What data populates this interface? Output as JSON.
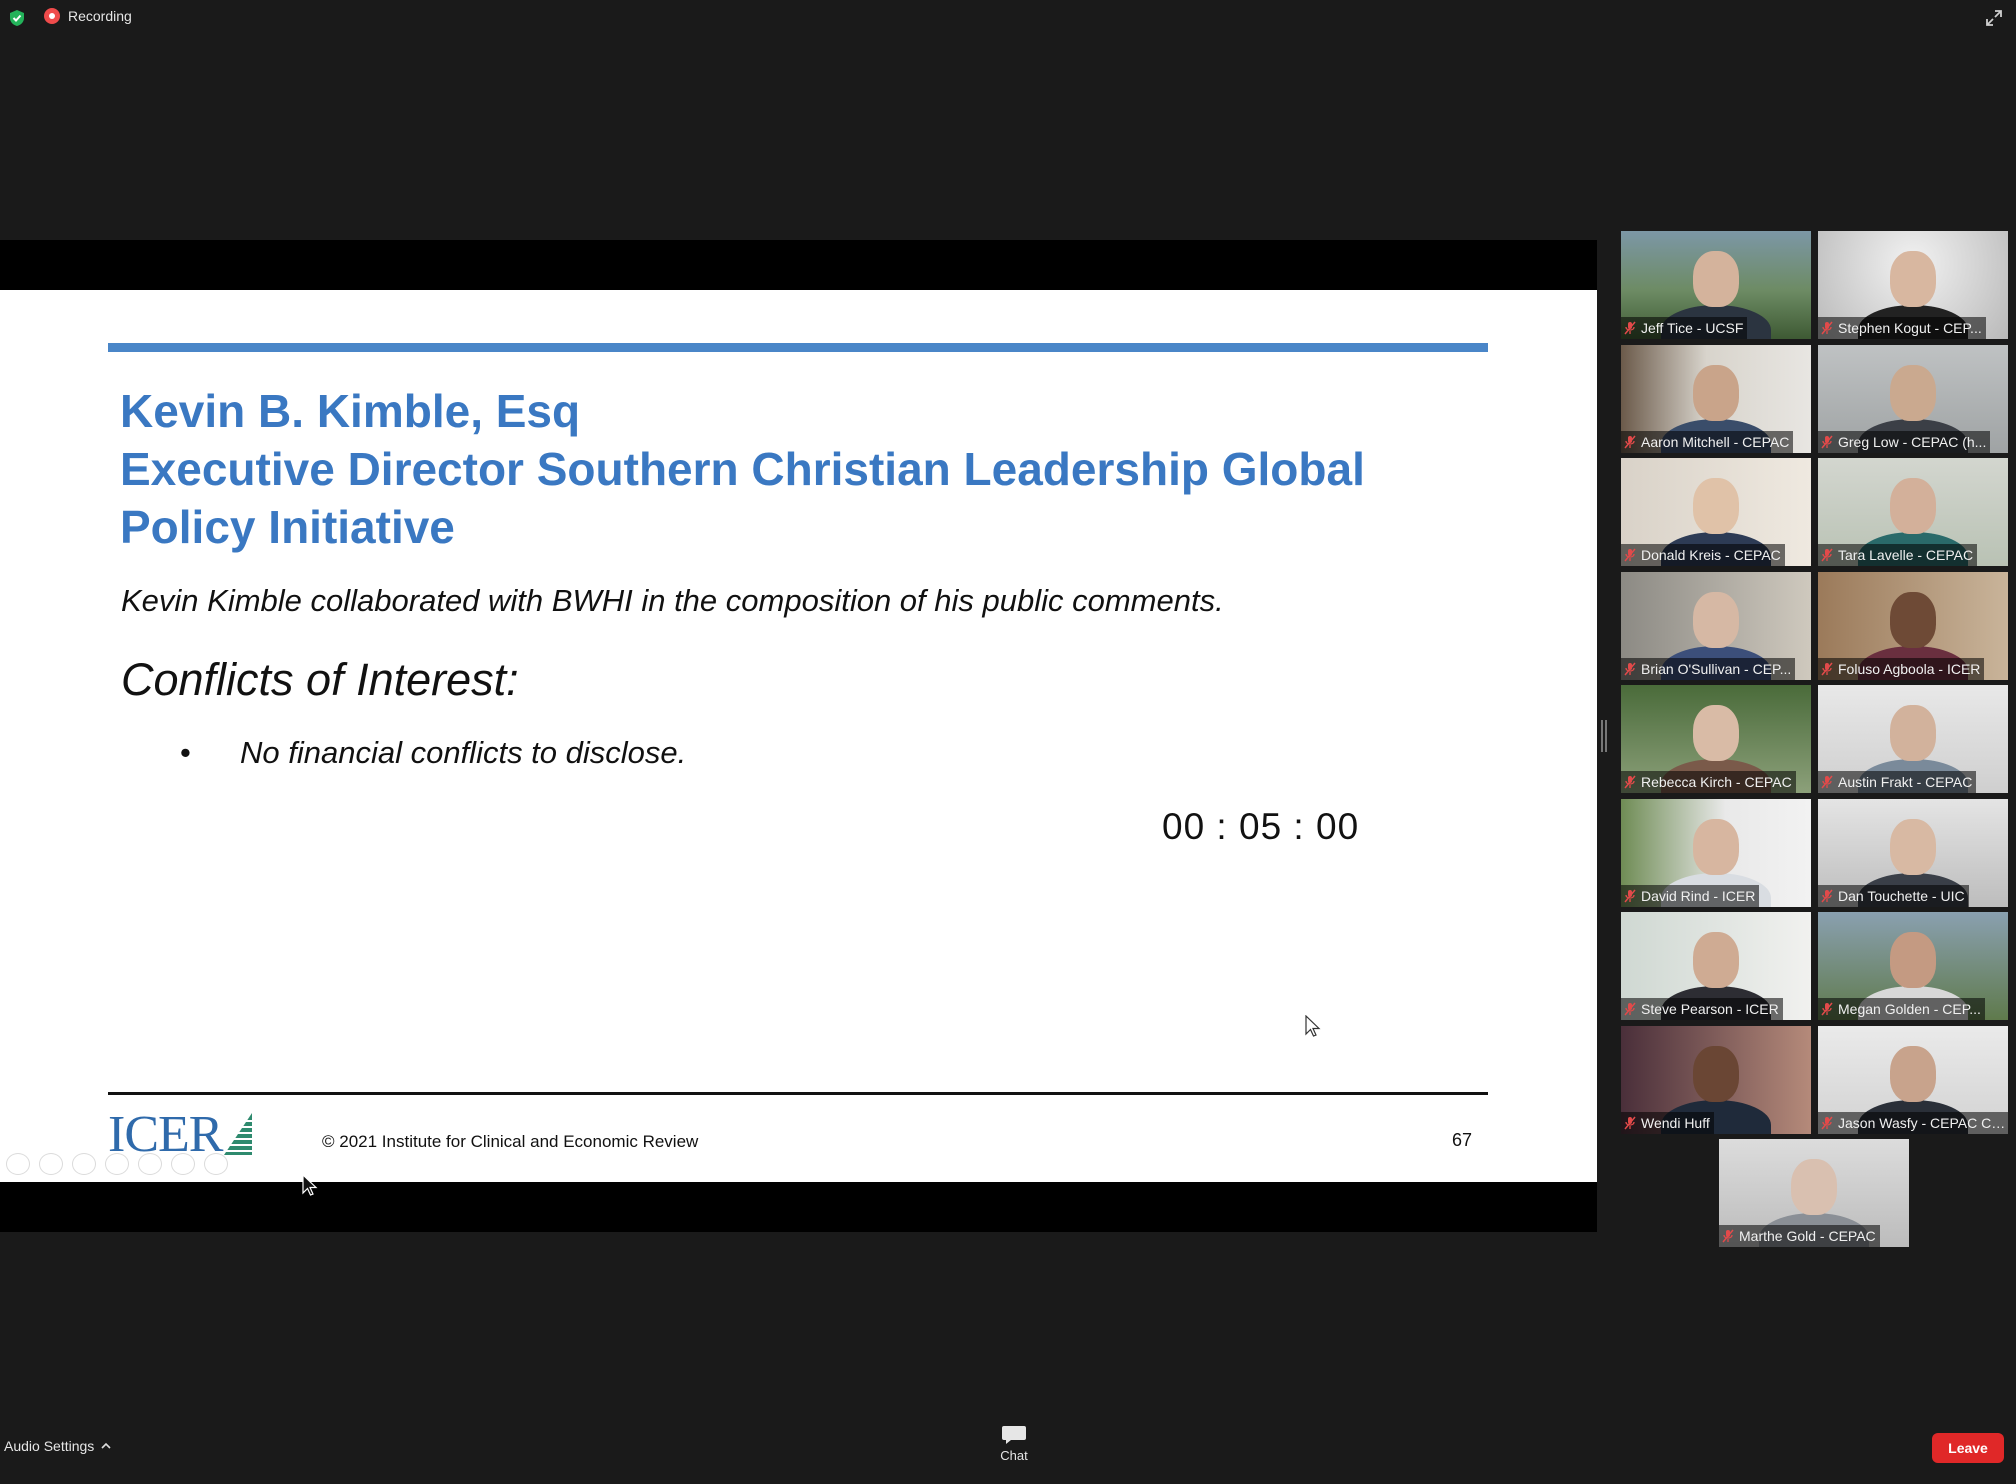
{
  "meeting": {
    "recording_label": "Recording",
    "shield_icon": "shield-check-icon",
    "fullscreen_icon": "expand-icon"
  },
  "slide": {
    "title_lines": [
      "Kevin B. Kimble, Esq",
      "Executive Director Southern Christian Leadership Global",
      "Policy Initiative"
    ],
    "note": "Kevin Kimble collaborated with BWHI in the composition of his public comments.",
    "conflicts_heading": "Conflicts of Interest:",
    "bullet_marker": "•",
    "bullet": "No financial conflicts to disclose.",
    "timer": "00 : 05 : 00",
    "logo_text": "ICER",
    "copyright": "© 2021 Institute for Clinical and Economic Review",
    "page_number": "67",
    "accent_color": "#3a78c2"
  },
  "participants": [
    {
      "name": "Jeff Tice - UCSF"
    },
    {
      "name": "Stephen Kogut - CEP..."
    },
    {
      "name": "Aaron Mitchell - CEPAC"
    },
    {
      "name": "Greg Low - CEPAC (h..."
    },
    {
      "name": "Donald Kreis - CEPAC"
    },
    {
      "name": "Tara Lavelle - CEPAC"
    },
    {
      "name": "Brian O'Sullivan - CEP..."
    },
    {
      "name": "Foluso Agboola - ICER"
    },
    {
      "name": "Rebecca Kirch - CEPAC"
    },
    {
      "name": "Austin Frakt - CEPAC"
    },
    {
      "name": "David Rind - ICER"
    },
    {
      "name": "Dan Touchette - UIC"
    },
    {
      "name": "Steve Pearson - ICER"
    },
    {
      "name": "Megan Golden - CEP..."
    },
    {
      "name": "Wendi Huff"
    },
    {
      "name": "Jason Wasfy - CEPAC Ch..."
    },
    {
      "name": "Marthe Gold - CEPAC"
    }
  ],
  "bottom_bar": {
    "audio_settings": "Audio Settings",
    "chat": "Chat",
    "leave": "Leave"
  }
}
